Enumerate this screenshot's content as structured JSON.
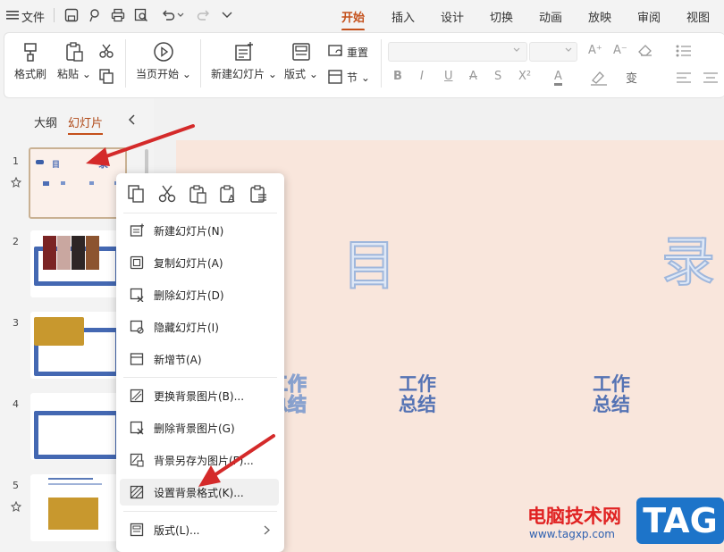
{
  "menubar": {
    "file_label": "文件",
    "tabs": [
      "开始",
      "插入",
      "设计",
      "切换",
      "动画",
      "放映",
      "审阅",
      "视图"
    ],
    "active_tab": "开始"
  },
  "ribbon": {
    "format_painter": "格式刷",
    "paste": "粘贴",
    "play_from_current": "当页开始",
    "new_slide": "新建幻灯片",
    "layout": "版式",
    "reset": "重置",
    "section": "节",
    "format_glyphs": [
      "B",
      "I",
      "U",
      "A",
      "S",
      "X²",
      "A"
    ]
  },
  "left_panel": {
    "tab_outline": "大纲",
    "tab_slides": "幻灯片",
    "slide_numbers": [
      "1",
      "2",
      "3",
      "4",
      "5"
    ],
    "thumb1_title_a": "目",
    "thumb1_title_b": "录"
  },
  "slide": {
    "char_left": "目",
    "char_right": "录",
    "items": [
      "工作\n总结",
      "工作\n总结",
      "工作\n总结"
    ]
  },
  "context_menu": {
    "items": [
      {
        "label": "新建幻灯片(N)",
        "icon": "new-slide-icon"
      },
      {
        "label": "复制幻灯片(A)",
        "icon": "copy-slide-icon"
      },
      {
        "label": "删除幻灯片(D)",
        "icon": "delete-slide-icon"
      },
      {
        "label": "隐藏幻灯片(I)",
        "icon": "hide-slide-icon"
      },
      {
        "label": "新增节(A)",
        "icon": "add-section-icon"
      },
      {
        "label": "更换背景图片(B)...",
        "icon": "change-bg-icon"
      },
      {
        "label": "删除背景图片(G)",
        "icon": "delete-bg-icon"
      },
      {
        "label": "背景另存为图片(F)...",
        "icon": "save-bg-icon"
      },
      {
        "label": "设置背景格式(K)...",
        "icon": "format-bg-icon"
      },
      {
        "label": "版式(L)...",
        "icon": "layout-icon"
      }
    ],
    "highlighted": "设置背景格式(K)..."
  },
  "watermark": {
    "site_name": "电脑技术网",
    "site_url": "www.tagxp.com",
    "tag": "TAG"
  },
  "colors": {
    "accent": "#c4501b",
    "slide_bg": "#f9e6dc",
    "arrow": "#d42a2a",
    "tag_bg": "#1d74c9"
  }
}
